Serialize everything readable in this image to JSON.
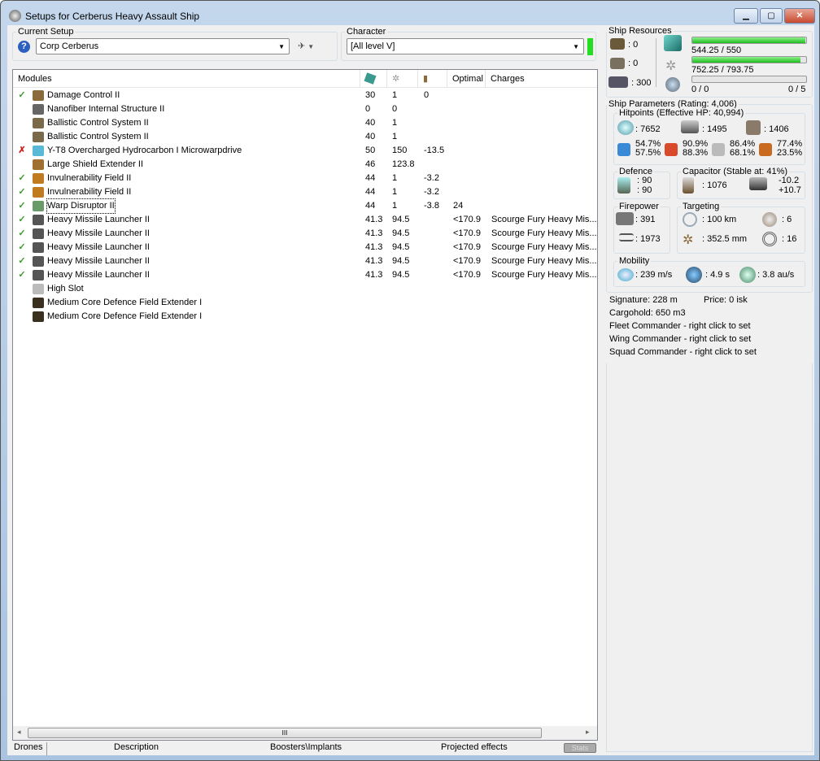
{
  "window": {
    "title": "Setups for Cerberus Heavy Assault Ship",
    "min": "▁",
    "max": "▢",
    "close": "✕"
  },
  "setup": {
    "label": "Current Setup",
    "value": "Corp Cerberus"
  },
  "character": {
    "label": "Character",
    "value": "[All level V]",
    "status_color": "#22dd22"
  },
  "modules": {
    "headers": [
      "Modules",
      "",
      "",
      "",
      "Optimal",
      "Charges"
    ],
    "header_icons": [
      "cpu-icon",
      "powergrid-icon",
      "capacitor-icon"
    ],
    "rows": [
      {
        "status": "ok",
        "name": "Damage Control II",
        "cpu": "30",
        "pg": "1",
        "cap": "0",
        "optimal": "",
        "charges": "",
        "color": "#8a6a3a"
      },
      {
        "status": "",
        "name": "Nanofiber Internal Structure II",
        "cpu": "0",
        "pg": "0",
        "cap": "",
        "optimal": "",
        "charges": "",
        "color": "#666"
      },
      {
        "status": "",
        "name": "Ballistic Control System II",
        "cpu": "40",
        "pg": "1",
        "cap": "",
        "optimal": "",
        "charges": "",
        "color": "#7a6a4a"
      },
      {
        "status": "",
        "name": "Ballistic Control System II",
        "cpu": "40",
        "pg": "1",
        "cap": "",
        "optimal": "",
        "charges": "",
        "color": "#7a6a4a"
      },
      {
        "status": "err",
        "name": "Y-T8 Overcharged Hydrocarbon I Microwarpdrive",
        "cpu": "50",
        "pg": "150",
        "cap": "-13.5",
        "optimal": "",
        "charges": "",
        "color": "#5ab8d8"
      },
      {
        "status": "",
        "name": "Large Shield Extender II",
        "cpu": "46",
        "pg": "123.8",
        "cap": "",
        "optimal": "",
        "charges": "",
        "color": "#a07030"
      },
      {
        "status": "ok",
        "name": "Invulnerability Field II",
        "cpu": "44",
        "pg": "1",
        "cap": "-3.2",
        "optimal": "",
        "charges": "",
        "color": "#c07a20"
      },
      {
        "status": "ok",
        "name": "Invulnerability Field II",
        "cpu": "44",
        "pg": "1",
        "cap": "-3.2",
        "optimal": "",
        "charges": "",
        "color": "#c07a20"
      },
      {
        "status": "ok",
        "name": "Warp Disruptor II",
        "cpu": "44",
        "pg": "1",
        "cap": "-3.8",
        "optimal": "24",
        "charges": "",
        "color": "#6a9a6a"
      },
      {
        "status": "ok",
        "name": "Heavy Missile Launcher II",
        "cpu": "41.3",
        "pg": "94.5",
        "cap": "",
        "optimal": "<170.9",
        "charges": "Scourge Fury Heavy Mis...",
        "color": "#555"
      },
      {
        "status": "ok",
        "name": "Heavy Missile Launcher II",
        "cpu": "41.3",
        "pg": "94.5",
        "cap": "",
        "optimal": "<170.9",
        "charges": "Scourge Fury Heavy Mis...",
        "color": "#555"
      },
      {
        "status": "ok",
        "name": "Heavy Missile Launcher II",
        "cpu": "41.3",
        "pg": "94.5",
        "cap": "",
        "optimal": "<170.9",
        "charges": "Scourge Fury Heavy Mis...",
        "color": "#555"
      },
      {
        "status": "ok",
        "name": "Heavy Missile Launcher II",
        "cpu": "41.3",
        "pg": "94.5",
        "cap": "",
        "optimal": "<170.9",
        "charges": "Scourge Fury Heavy Mis...",
        "color": "#555"
      },
      {
        "status": "ok",
        "name": "Heavy Missile Launcher II",
        "cpu": "41.3",
        "pg": "94.5",
        "cap": "",
        "optimal": "<170.9",
        "charges": "Scourge Fury Heavy Mis...",
        "color": "#555"
      },
      {
        "status": "",
        "name": "High Slot",
        "cpu": "",
        "pg": "",
        "cap": "",
        "optimal": "",
        "charges": "",
        "color": "#bbb"
      },
      {
        "status": "",
        "name": "Medium Core Defence Field Extender I",
        "cpu": "",
        "pg": "",
        "cap": "",
        "optimal": "",
        "charges": "",
        "color": "#3a3020"
      },
      {
        "status": "",
        "name": "Medium Core Defence Field Extender I",
        "cpu": "",
        "pg": "",
        "cap": "",
        "optimal": "",
        "charges": "",
        "color": "#3a3020"
      }
    ]
  },
  "tabs": [
    "Drones",
    "Description",
    "Boosters\\Implants",
    "Projected effects",
    "Stats"
  ],
  "resources": {
    "label": "Ship Resources",
    "turrets": ": 0",
    "launchers": ": 0",
    "drone_bay": ": 300",
    "cpu": "544.25 / 550",
    "cpu_pct": 98.95,
    "pg": "752.25 / 793.75",
    "pg_pct": 94.77,
    "drone_bw": "0 / 0",
    "drones": "0 / 5",
    "drone_pct": 0
  },
  "params": {
    "label": "Ship Parameters (Rating: 4,006)",
    "hitpoints": {
      "label": "Hitpoints (Effective HP: 40,994)",
      "shield": ": 7652",
      "armor": ": 1495",
      "structure": ": 1406",
      "res": [
        [
          "54.7%",
          "57.5%"
        ],
        [
          "90.9%",
          "88.3%"
        ],
        [
          "86.4%",
          "68.1%"
        ],
        [
          "77.4%",
          "23.5%"
        ]
      ]
    },
    "defence": {
      "label": "Defence",
      "a": ": 90",
      "b": ": 90"
    },
    "capacitor": {
      "label": "Capacitor (Stable at: 41%)",
      "amount": ": 1076",
      "use": "-10.2",
      "recharge": "+10.7"
    },
    "firepower": {
      "label": "Firepower",
      "dps": ": 391",
      "volley": ": 1973"
    },
    "targeting": {
      "label": "Targeting",
      "range": ": 100 km",
      "targets": ": 6",
      "scan": ": 352.5 mm",
      "sensor": ": 16"
    },
    "mobility": {
      "label": "Mobility",
      "speed": ": 239 m/s",
      "align": ": 4.9 s",
      "warp": ": 3.8 au/s"
    }
  },
  "info": [
    "Signature: 228 m",
    "Price: 0 isk",
    "Cargohold: 650 m3",
    "Fleet Commander - right click to set",
    "Wing Commander - right click to set",
    "Squad Commander - right click to set"
  ]
}
